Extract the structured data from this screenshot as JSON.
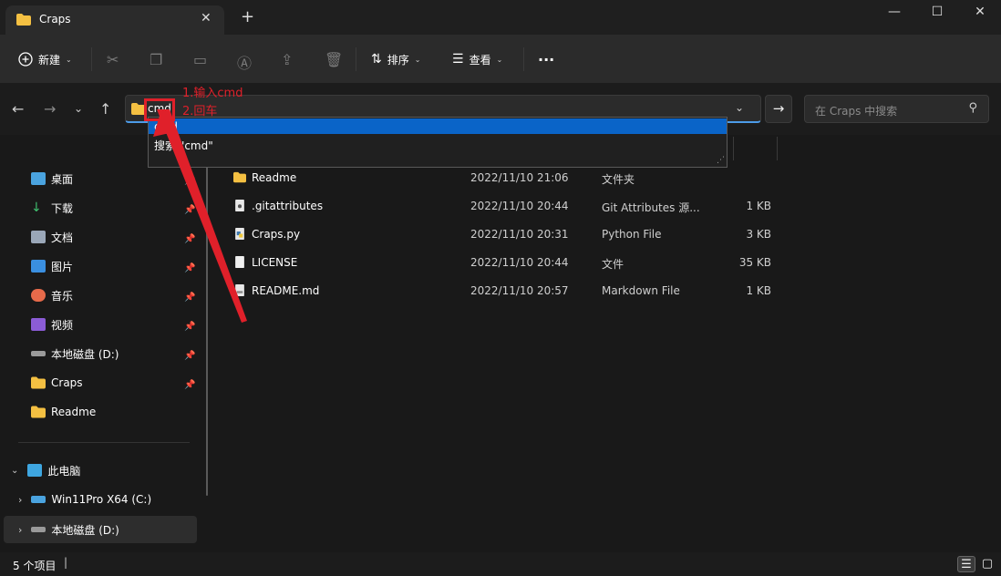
{
  "tab": {
    "title": "Craps",
    "close": "✕",
    "new_tab": "+"
  },
  "window": {
    "minimize": "—",
    "maximize": "☐",
    "close": "✕"
  },
  "toolbar": {
    "new_label": "新建",
    "sort_label": "排序",
    "view_label": "查看",
    "more": "···"
  },
  "address": {
    "value": "cmd",
    "go": "→"
  },
  "search": {
    "placeholder": "在 Craps 中搜索"
  },
  "suggestions": [
    "cmd",
    "搜索 \"cmd\""
  ],
  "sidebar": {
    "items": [
      {
        "label": "桌面",
        "color": "#4aa3df"
      },
      {
        "label": "下载",
        "color": "#3fbf6f"
      },
      {
        "label": "文档",
        "color": "#9aa7b8"
      },
      {
        "label": "图片",
        "color": "#3a8fe0"
      },
      {
        "label": "音乐",
        "color": "#e66a4a"
      },
      {
        "label": "视频",
        "color": "#8b5cd6"
      },
      {
        "label": "本地磁盘 (D:)",
        "color": "#9a9a9a"
      },
      {
        "label": "Craps",
        "color": "#f4c042"
      },
      {
        "label": "Readme",
        "color": "#f4c042"
      }
    ],
    "this_pc": "此电脑",
    "drives": [
      {
        "label": "Win11Pro X64 (C:)"
      },
      {
        "label": "本地磁盘 (D:)"
      }
    ]
  },
  "files": [
    {
      "name": "Readme",
      "date": "2022/11/10 21:06",
      "type": "文件夹",
      "size": ""
    },
    {
      "name": ".gitattributes",
      "date": "2022/11/10 20:44",
      "type": "Git Attributes 源...",
      "size": "1 KB"
    },
    {
      "name": "Craps.py",
      "date": "2022/11/10 20:31",
      "type": "Python File",
      "size": "3 KB"
    },
    {
      "name": "LICENSE",
      "date": "2022/11/10 20:44",
      "type": "文件",
      "size": "35 KB"
    },
    {
      "name": "README.md",
      "date": "2022/11/10 20:57",
      "type": "Markdown File",
      "size": "1 KB"
    }
  ],
  "status": {
    "count": "5 个项目"
  },
  "annotations": {
    "step1": "1.输入cmd",
    "step2": "2.回车"
  }
}
